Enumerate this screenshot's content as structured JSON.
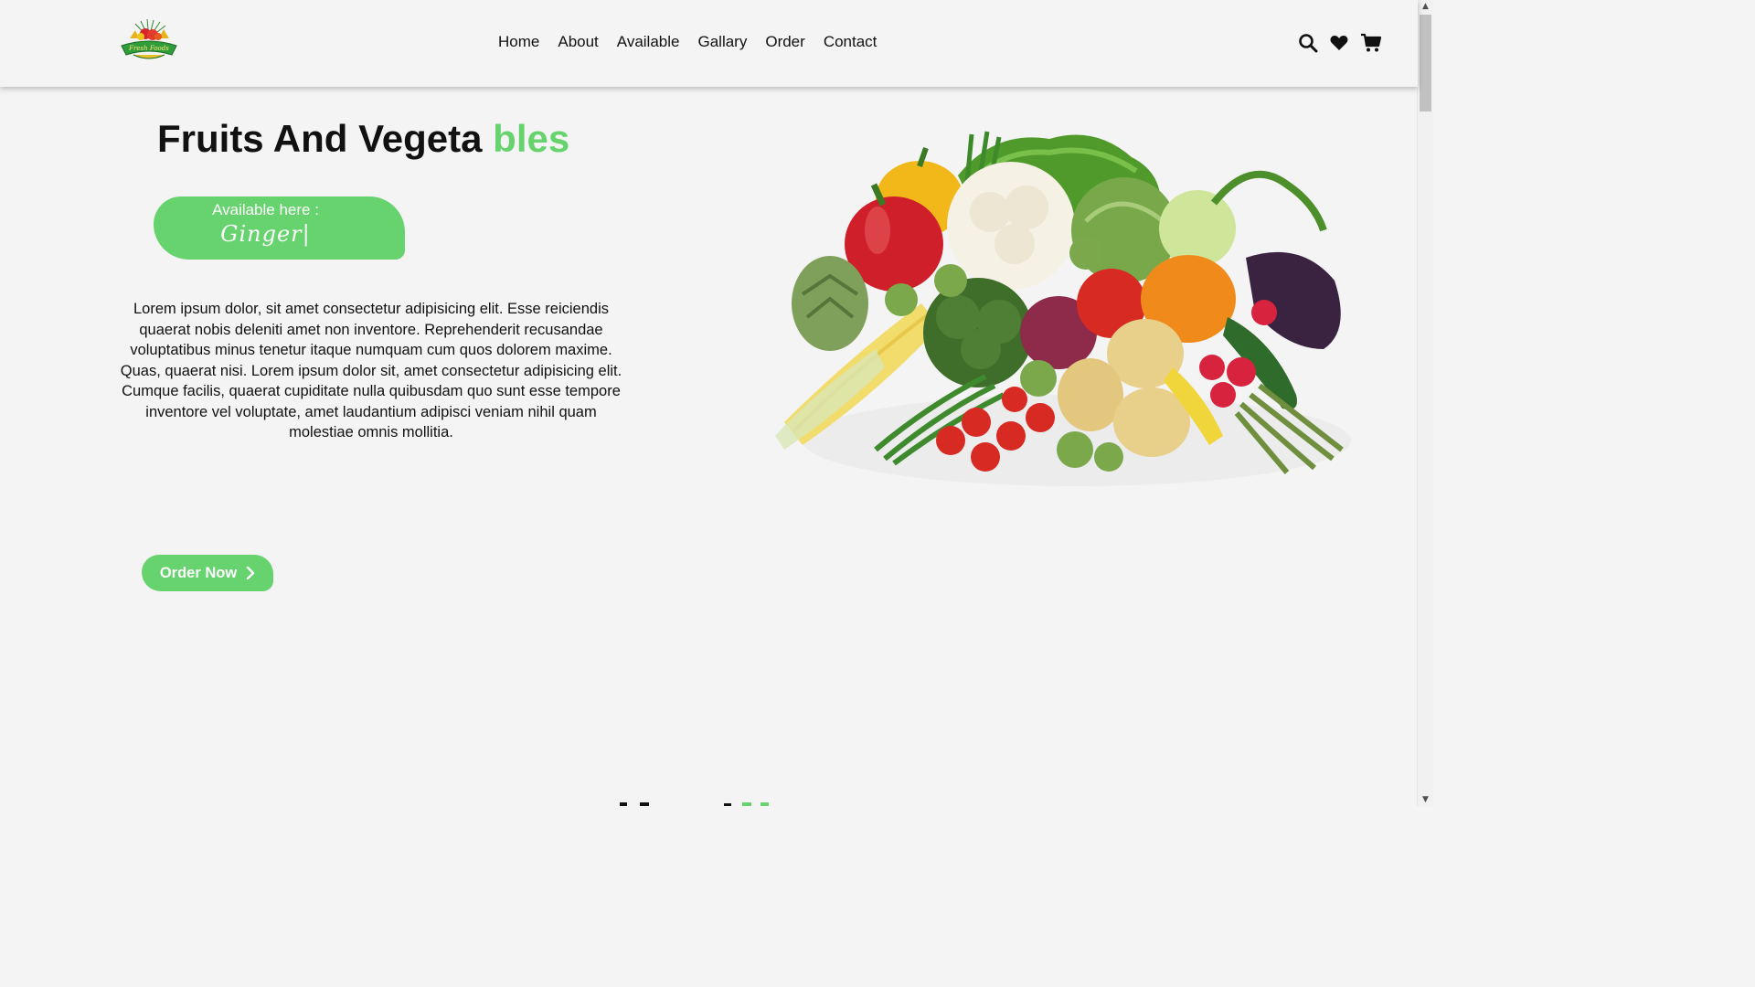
{
  "colors": {
    "accent": "#66d36e",
    "background": "#f4f4f4",
    "text": "#111111"
  },
  "logo": {
    "text": "Fresh Foods"
  },
  "nav": {
    "items": [
      "Home",
      "About",
      "Available",
      "Gallary",
      "Order",
      "Contact"
    ]
  },
  "header_icons": [
    "search-icon",
    "heart-icon",
    "cart-icon"
  ],
  "hero": {
    "title_main": "Fruits And Vegeta ",
    "title_accent": "bles",
    "available_label": "Available here :",
    "available_value": "Ginger|",
    "description": "Lorem ipsum dolor, sit amet consectetur adipisicing elit. Esse reiciendis quaerat nobis deleniti amet non inventore. Reprehenderit recusandae voluptatibus minus tenetur itaque numquam cum quos dolorem maxime. Quas, quaerat nisi. Lorem ipsum dolor sit, amet consectetur adipisicing elit. Cumque facilis, quaerat cupiditate nulla quibusdam quo sunt esse tempore inventore vel voluptate, amet laudantium adipisci veniam nihil quam molestiae omnis mollitia.",
    "order_button": "Order Now",
    "order_icon": "chevron-right-icon"
  }
}
